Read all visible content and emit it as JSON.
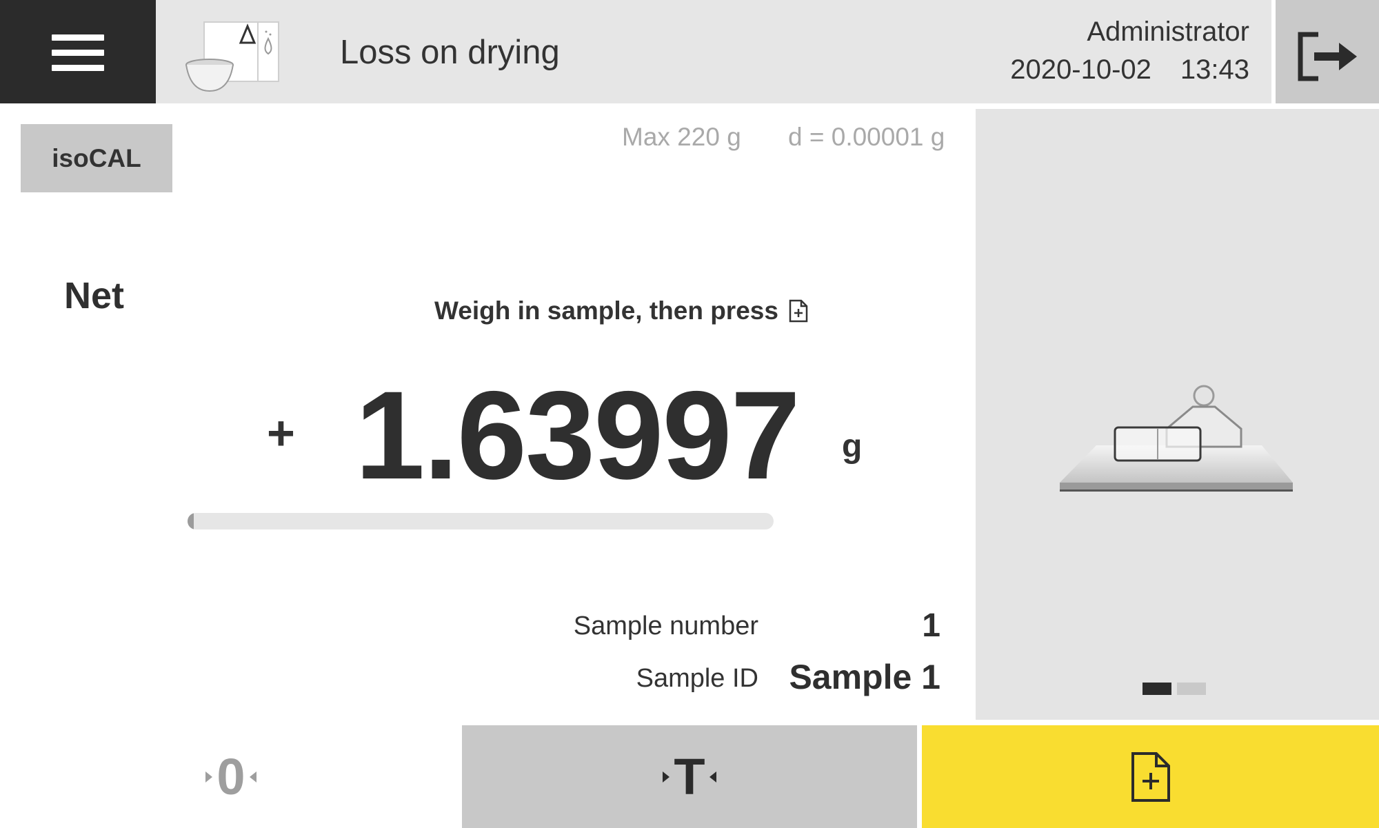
{
  "header": {
    "app_title": "Loss on drying",
    "user": "Administrator",
    "date": "2020-10-02",
    "time": "13:43"
  },
  "icons": {
    "menu": "hamburger-menu-icon",
    "app": "loss-on-drying-icon",
    "logout": "logout-icon",
    "add_result": "add-document-icon",
    "balance": "balance-with-containers-icon"
  },
  "balance": {
    "isocal_label": "isoCAL",
    "max_capacity": "Max 220 g",
    "readability": "d = 0.00001 g",
    "mode_label": "Net",
    "instruction": "Weigh in sample, then press",
    "sign": "+",
    "value": "1.63997",
    "unit": "g",
    "weighing_progress_fraction": 0.01
  },
  "sample": {
    "number_label": "Sample number",
    "number_value": "1",
    "id_label": "Sample ID",
    "id_value": "Sample 1"
  },
  "side_panel": {
    "page_indicator": {
      "current": 1,
      "total": 2
    }
  },
  "footer": {
    "zero_label": "0",
    "tare_label": "T"
  },
  "colors": {
    "accent_yellow": "#f9dd30",
    "dark": "#2b2b2b",
    "header_bg": "#e6e6e6",
    "panel_bg": "#e4e4e4",
    "button_gray": "#c8c8c8",
    "muted_text": "#a9a9a9"
  }
}
